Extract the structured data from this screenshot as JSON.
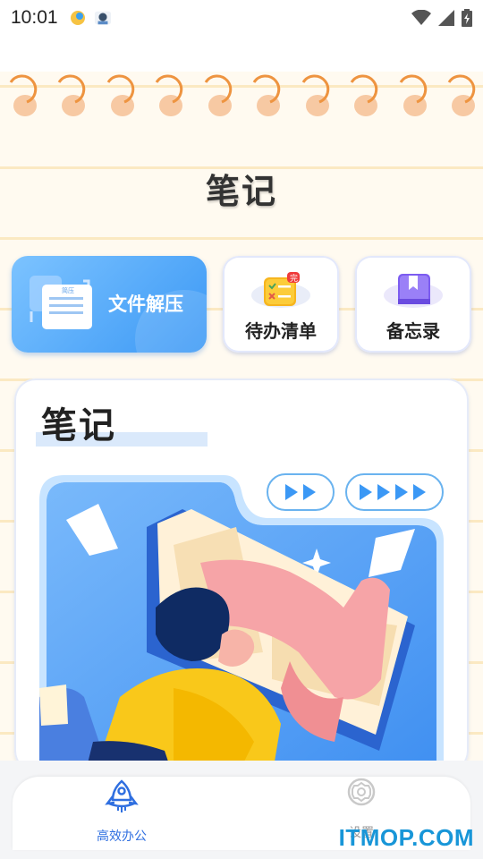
{
  "status_bar": {
    "time": "10:01"
  },
  "page": {
    "title": "笔记"
  },
  "tools": [
    {
      "label": "文件解压",
      "icon": "document-icon",
      "badge": "简压"
    },
    {
      "label": "待办清单",
      "icon": "checklist-icon",
      "badge": "完"
    },
    {
      "label": "备忘录",
      "icon": "bookmark-book-icon"
    }
  ],
  "note_card": {
    "heading": "笔记"
  },
  "bottom_nav": [
    {
      "label": "高效办公",
      "icon": "rocket-icon",
      "active": true
    },
    {
      "label": "设置",
      "icon": "gear-icon",
      "active": false
    }
  ],
  "watermark": "ITMOP.COM",
  "colors": {
    "accent_blue": "#3b98f5",
    "ring_orange": "#f0a050",
    "nav_active": "#2f6fe0"
  }
}
